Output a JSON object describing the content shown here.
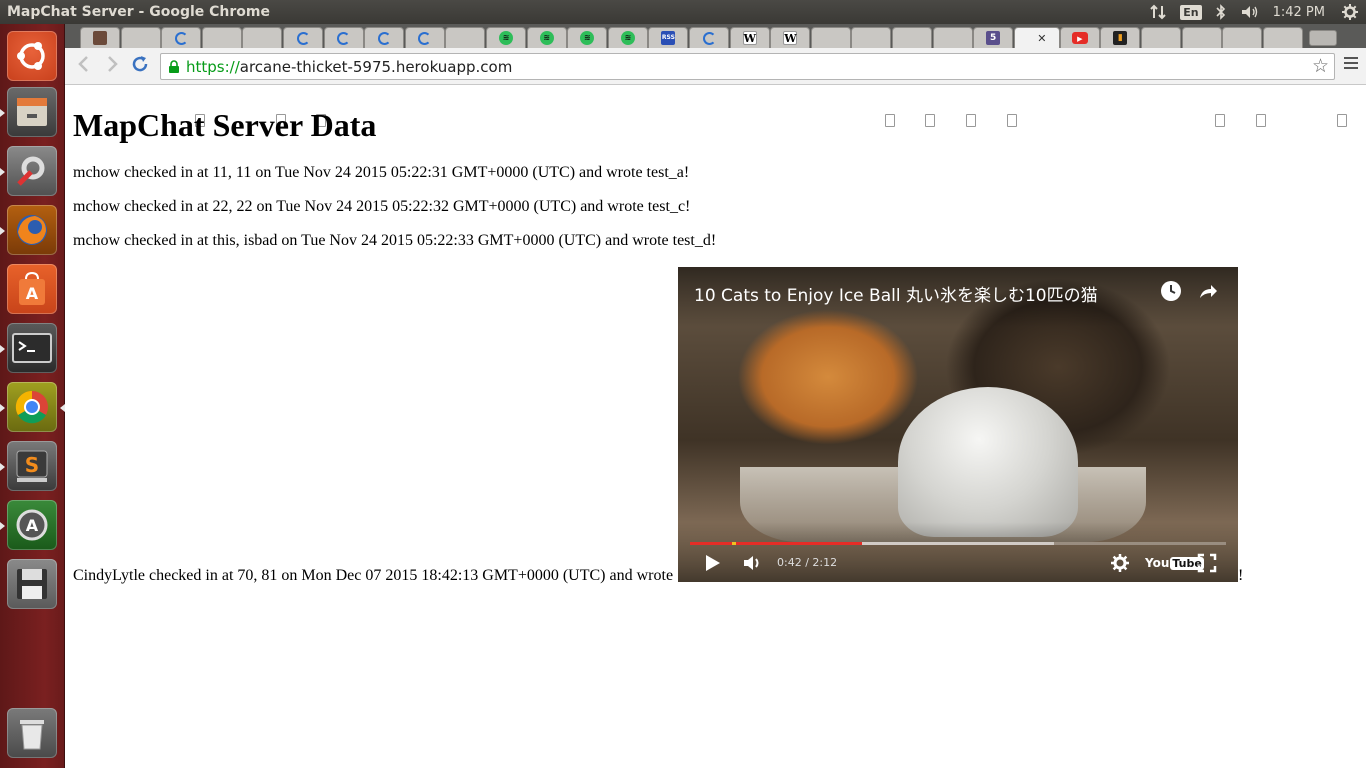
{
  "window": {
    "title": "MapChat Server - Google Chrome"
  },
  "tray": {
    "language": "En",
    "clock": "1:42 PM"
  },
  "tabs": [
    {
      "icon": "avatar-icon"
    },
    {
      "icon": "page-icon"
    },
    {
      "icon": "loading-icon"
    },
    {
      "icon": "page-icon"
    },
    {
      "icon": "page-icon"
    },
    {
      "icon": "loading-icon"
    },
    {
      "icon": "loading-icon"
    },
    {
      "icon": "loading-icon"
    },
    {
      "icon": "loading-icon"
    },
    {
      "icon": "blank-icon"
    },
    {
      "icon": "spotify-icon"
    },
    {
      "icon": "spotify-icon"
    },
    {
      "icon": "spotify-icon"
    },
    {
      "icon": "spotify-icon"
    },
    {
      "icon": "rss-icon"
    },
    {
      "icon": "loading-icon"
    },
    {
      "icon": "wikipedia-icon",
      "glyph": "W"
    },
    {
      "icon": "wikipedia-icon",
      "glyph": "W"
    },
    {
      "icon": "page-icon"
    },
    {
      "icon": "page-icon"
    },
    {
      "icon": "page-icon"
    },
    {
      "icon": "page-icon"
    },
    {
      "icon": "html5-icon",
      "glyph": "5"
    },
    {
      "icon": "active-tab",
      "active": true
    },
    {
      "icon": "youtube-icon"
    },
    {
      "icon": "app-icon"
    },
    {
      "icon": "page-icon"
    },
    {
      "icon": "page-icon"
    },
    {
      "icon": "blank-icon"
    },
    {
      "icon": "page-icon"
    }
  ],
  "toolbar": {
    "url_scheme": "https://",
    "url_host": "arcane-thicket-5975.herokuapp.com"
  },
  "page": {
    "heading": "MapChat Server Data",
    "entries": [
      "mchow checked in at 11, 11 on Tue Nov 24 2015 05:22:31 GMT+0000 (UTC) and wrote test_a!",
      "mchow checked in at 22, 22 on Tue Nov 24 2015 05:22:32 GMT+0000 (UTC) and wrote test_c!",
      "mchow checked in at this, isbad on Tue Nov 24 2015 05:22:33 GMT+0000 (UTC) and wrote test_d!",
      "CindyLytle checked in at 70, 81 on Mon Dec 07 2015 18:42:13 GMT+0000 (UTC) and wrote"
    ],
    "entry_suffix": "!"
  },
  "video": {
    "title": "10 Cats to Enjoy Ice Ball 丸い氷を楽しむ10匹の猫",
    "time": "0:42 / 2:12",
    "progress_fraction": 0.32,
    "buffered_fraction": 0.68,
    "logo_text": "You",
    "logo_tube": "Tube"
  },
  "colors": {
    "launcher": "#7a2020",
    "url_scheme": "#079c19",
    "progress": "#e52d27"
  }
}
